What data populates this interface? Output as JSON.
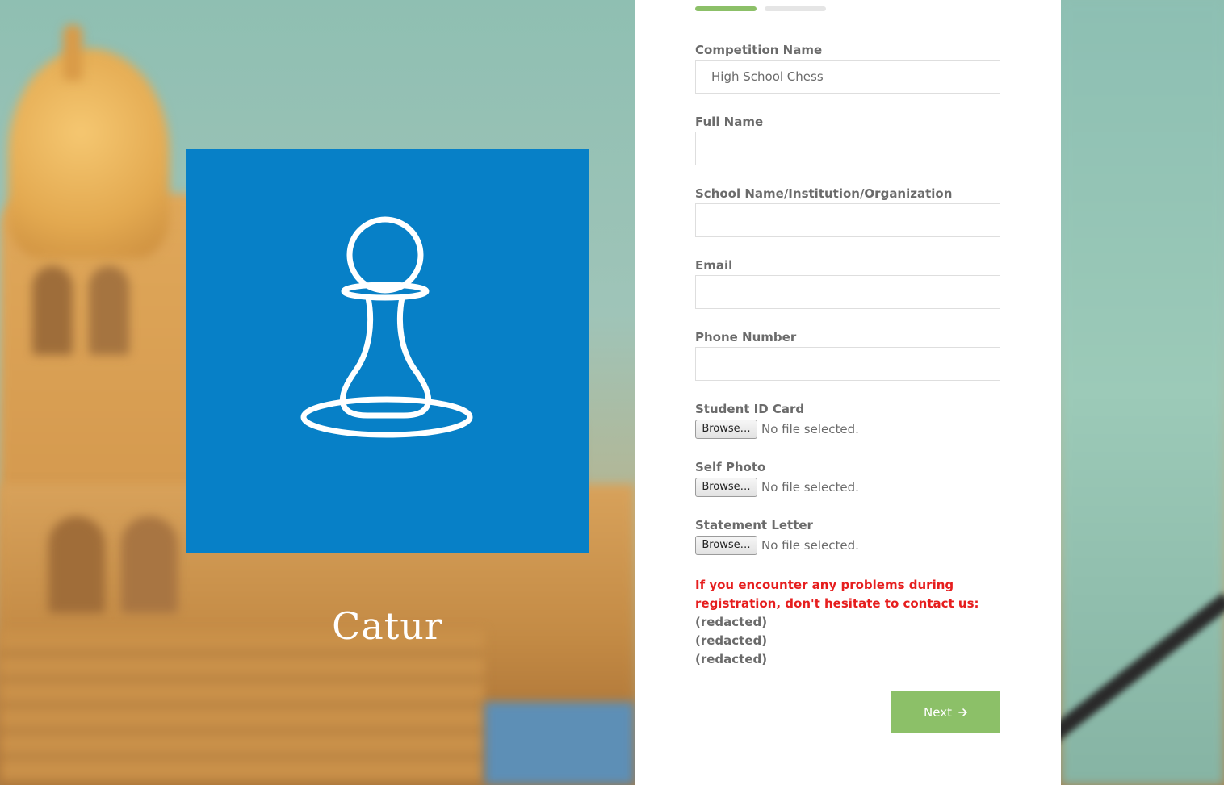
{
  "progress": {
    "steps_total": 2,
    "current_step": 1
  },
  "logo": {
    "brand_text": "Catur",
    "icon": "pawn-icon",
    "background_color": "#0780c7"
  },
  "form": {
    "fields": [
      {
        "label": "Competition Name",
        "value": "High School Chess"
      },
      {
        "label": "Full Name",
        "value": ""
      },
      {
        "label": "School Name/Institution/Organization",
        "value": ""
      },
      {
        "label": "Email",
        "value": ""
      },
      {
        "label": "Phone Number",
        "value": ""
      }
    ],
    "file_fields": [
      {
        "label": "Student ID Card",
        "button": "Browse…",
        "status": "No file selected."
      },
      {
        "label": "Self Photo",
        "button": "Browse…",
        "status": "No file selected."
      },
      {
        "label": "Statement Letter",
        "button": "Browse…",
        "status": "No file selected."
      }
    ],
    "notice": {
      "message": "If you encounter any problems during registration, don't hesitate to contact us:",
      "contacts": [
        "(redacted)",
        "(redacted)",
        "(redacted)"
      ]
    },
    "next_button": {
      "label": "Next",
      "icon": "arrow-right-icon"
    }
  },
  "colors": {
    "accent_green": "#8cc068",
    "warning_red": "#e61e1e",
    "label_gray": "#6b6b6b"
  }
}
